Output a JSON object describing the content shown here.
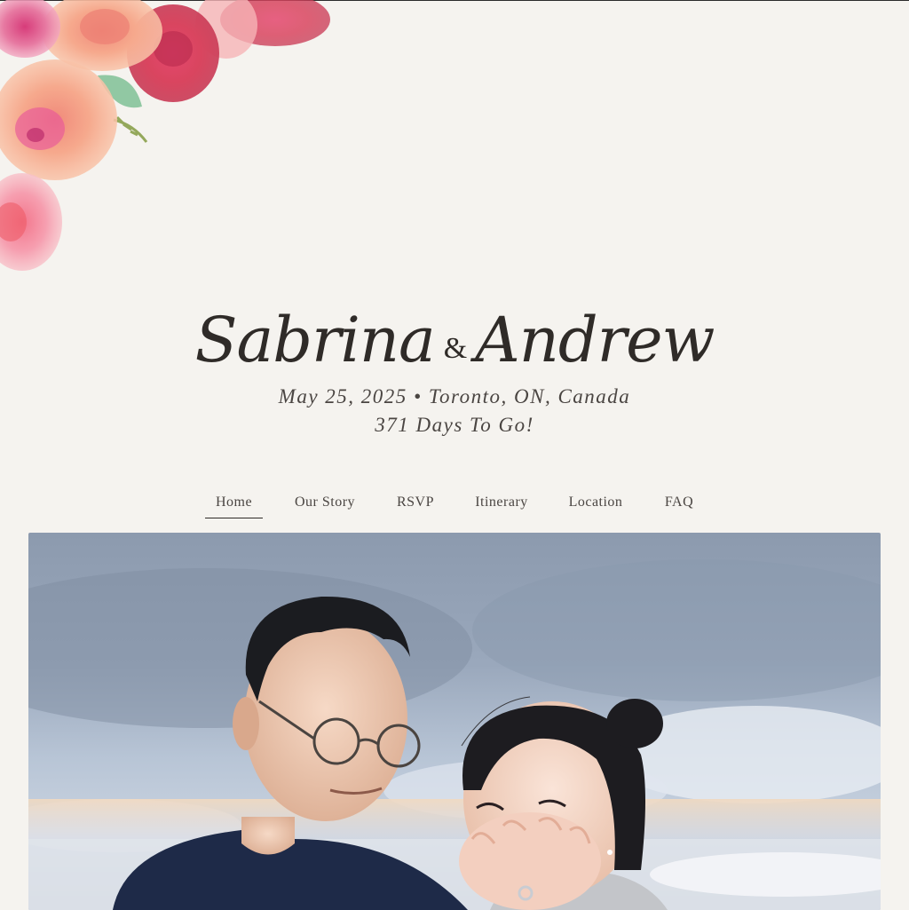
{
  "header": {
    "bride": "Sabrina",
    "amp": "&",
    "groom": "Andrew",
    "date_location": "May 25, 2025 • Toronto, ON, Canada",
    "countdown": "371 Days To Go!"
  },
  "nav": {
    "items": [
      {
        "label": "Home",
        "active": true
      },
      {
        "label": "Our Story"
      },
      {
        "label": "RSVP"
      },
      {
        "label": "Itinerary"
      },
      {
        "label": "Location"
      },
      {
        "label": "FAQ"
      }
    ]
  },
  "colors": {
    "background": "#f5f3ef",
    "text": "#3a3633",
    "accent_rose": "#e0728a",
    "accent_peach": "#f4a48a"
  },
  "icons": {
    "floral": "watercolor-floral-decoration"
  }
}
